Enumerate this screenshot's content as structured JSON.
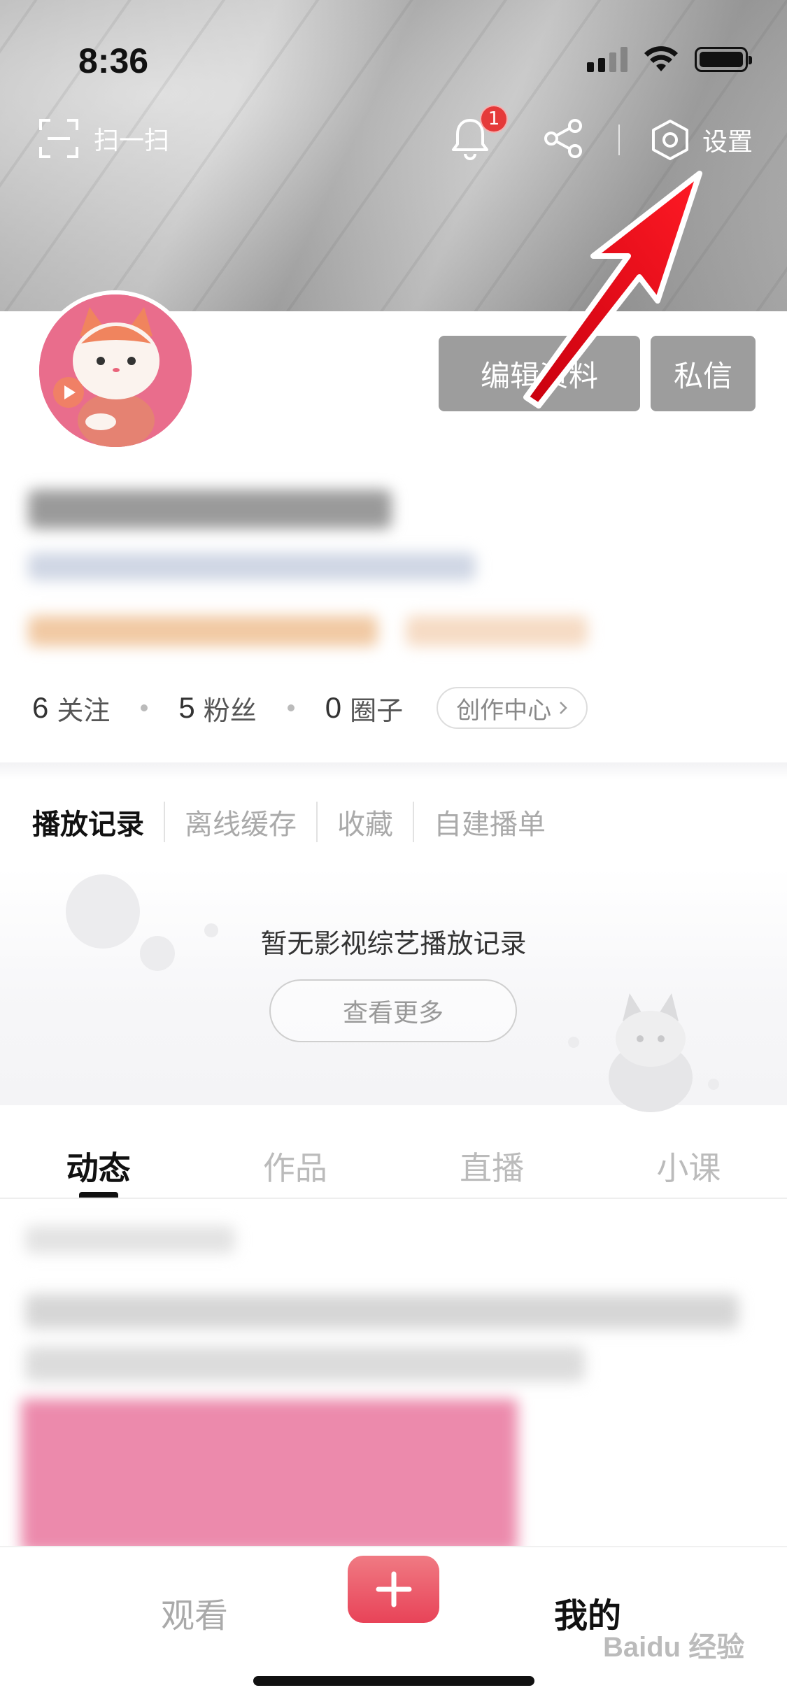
{
  "status_bar": {
    "time": "8:36"
  },
  "header": {
    "scan_label": "扫一扫",
    "notification_count": "1",
    "settings_label": "设置"
  },
  "profile": {
    "edit_button": "编辑资料",
    "message_button": "私信"
  },
  "stats": {
    "following_count": "6",
    "following_label": "关注",
    "fans_count": "5",
    "fans_label": "粉丝",
    "circles_count": "0",
    "circles_label": "圈子",
    "creator_center": "创作中心"
  },
  "history": {
    "tabs": [
      "播放记录",
      "离线缓存",
      "收藏",
      "自建播单"
    ],
    "empty_text": "暂无影视综艺播放记录",
    "more_button": "查看更多"
  },
  "content_tabs": [
    "动态",
    "作品",
    "直播",
    "小课"
  ],
  "tabbar": {
    "watch": "观看",
    "mine": "我的"
  },
  "watermark": "Baidu 经验",
  "colors": {
    "accent": "#e84358",
    "badge": "#e53a3a",
    "button_gray": "#9d9d9d",
    "annotation_arrow": "#e8101c"
  },
  "icons": [
    "scan-icon",
    "bell-icon",
    "share-icon",
    "settings-hex-icon",
    "chevron-right-icon",
    "plus-icon"
  ]
}
